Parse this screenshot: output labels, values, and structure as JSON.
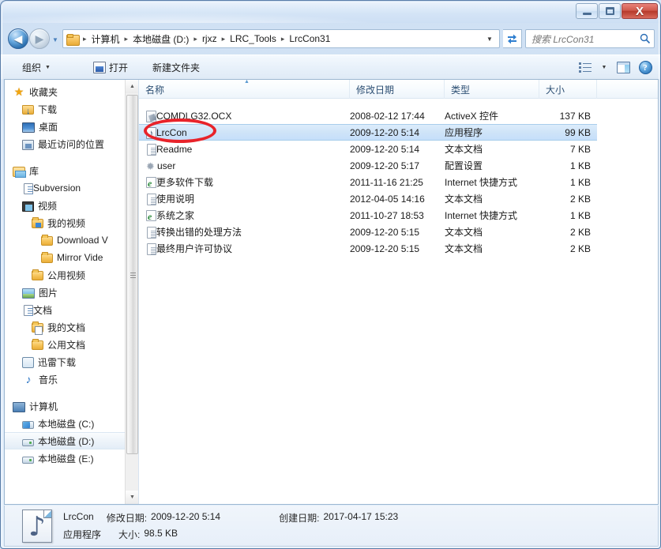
{
  "window": {
    "controls": {
      "minimize_label": "最小化",
      "maximize_label": "最大化",
      "close_label": "X"
    }
  },
  "address_bar": {
    "back_label": "◀",
    "forward_label": "▶",
    "history_caret": "▼",
    "dropdown_caret": "▼",
    "refresh_label": "↻",
    "breadcrumbs": [
      {
        "label": "计算机"
      },
      {
        "label": "本地磁盘 (D:)"
      },
      {
        "label": "rjxz"
      },
      {
        "label": "LRC_Tools"
      },
      {
        "label": "LrcCon31"
      }
    ],
    "separator": "▸"
  },
  "search": {
    "placeholder": "搜索 LrcCon31",
    "icon": "search-icon"
  },
  "toolbar": {
    "organize_label": "组织",
    "organize_caret": "▼",
    "open_label": "打开",
    "new_folder_label": "新建文件夹",
    "views_caret": "▼",
    "help_label": "?"
  },
  "sidebar": {
    "groups": [
      {
        "items": [
          {
            "label": "收藏夹",
            "icon": "star-icon",
            "indent": 0,
            "selected": false
          },
          {
            "label": "下载",
            "icon": "download-folder-icon",
            "indent": 1,
            "selected": false
          },
          {
            "label": "桌面",
            "icon": "desktop-icon",
            "indent": 1,
            "selected": false
          },
          {
            "label": "最近访问的位置",
            "icon": "recent-places-icon",
            "indent": 1,
            "selected": false
          }
        ]
      },
      {
        "items": [
          {
            "label": "库",
            "icon": "library-icon",
            "indent": 0,
            "selected": false
          },
          {
            "label": "Subversion",
            "icon": "document-icon",
            "indent": 1,
            "selected": false
          },
          {
            "label": "视频",
            "icon": "video-icon",
            "indent": 1,
            "selected": false
          },
          {
            "label": "我的视频",
            "icon": "folder-video-icon",
            "indent": 2,
            "selected": false
          },
          {
            "label": "Download V",
            "icon": "folder-icon",
            "indent": 3,
            "selected": false
          },
          {
            "label": "Mirror Vide",
            "icon": "folder-icon",
            "indent": 3,
            "selected": false
          },
          {
            "label": "公用视频",
            "icon": "folder-icon",
            "indent": 2,
            "selected": false
          },
          {
            "label": "图片",
            "icon": "picture-icon",
            "indent": 1,
            "selected": false
          },
          {
            "label": "文档",
            "icon": "document-icon",
            "indent": 1,
            "selected": false
          },
          {
            "label": "我的文档",
            "icon": "folder-doc-icon",
            "indent": 2,
            "selected": false
          },
          {
            "label": "公用文档",
            "icon": "folder-icon",
            "indent": 2,
            "selected": false
          },
          {
            "label": "迅雷下载",
            "icon": "thunder-download-icon",
            "indent": 1,
            "selected": false
          },
          {
            "label": "音乐",
            "icon": "music-icon",
            "indent": 1,
            "selected": false
          }
        ]
      },
      {
        "items": [
          {
            "label": "计算机",
            "icon": "computer-icon",
            "indent": 0,
            "selected": false
          },
          {
            "label": "本地磁盘 (C:)",
            "icon": "drive-system-icon",
            "indent": 1,
            "selected": false
          },
          {
            "label": "本地磁盘 (D:)",
            "icon": "drive-icon",
            "indent": 1,
            "selected": true
          },
          {
            "label": "本地磁盘 (E:)",
            "icon": "drive-icon",
            "indent": 1,
            "selected": false
          }
        ]
      }
    ],
    "scroll_up": "▲",
    "scroll_down": "▼"
  },
  "file_list": {
    "columns": [
      {
        "label": "名称",
        "sorted": true
      },
      {
        "label": "修改日期",
        "sorted": false
      },
      {
        "label": "类型",
        "sorted": false
      },
      {
        "label": "大小",
        "sorted": false
      }
    ],
    "rows": [
      {
        "name": "COMDLG32.OCX",
        "date": "2008-02-12 17:44",
        "type": "ActiveX 控件",
        "size": "137 KB",
        "icon": "ocx-file-icon",
        "selected": false
      },
      {
        "name": "LrcCon",
        "date": "2009-12-20 5:14",
        "type": "应用程序",
        "size": "99 KB",
        "icon": "application-music-icon",
        "selected": true
      },
      {
        "name": "Readme",
        "date": "2009-12-20 5:14",
        "type": "文本文档",
        "size": "7 KB",
        "icon": "text-file-icon",
        "selected": false
      },
      {
        "name": "user",
        "date": "2009-12-20 5:17",
        "type": "配置设置",
        "size": "1 KB",
        "icon": "config-file-icon",
        "selected": false
      },
      {
        "name": "更多软件下载",
        "date": "2011-11-16 21:25",
        "type": "Internet 快捷方式",
        "size": "1 KB",
        "icon": "internet-shortcut-icon",
        "selected": false
      },
      {
        "name": "使用说明",
        "date": "2012-04-05 14:16",
        "type": "文本文档",
        "size": "2 KB",
        "icon": "text-file-icon",
        "selected": false
      },
      {
        "name": "系统之家",
        "date": "2011-10-27 18:53",
        "type": "Internet 快捷方式",
        "size": "1 KB",
        "icon": "internet-shortcut-icon",
        "selected": false
      },
      {
        "name": "转换出错的处理方法",
        "date": "2009-12-20 5:15",
        "type": "文本文档",
        "size": "2 KB",
        "icon": "text-file-icon",
        "selected": false
      },
      {
        "name": "最终用户许可协议",
        "date": "2009-12-20 5:15",
        "type": "文本文档",
        "size": "2 KB",
        "icon": "text-file-icon",
        "selected": false
      }
    ]
  },
  "details_pane": {
    "file_name": "LrcCon",
    "modified_label": "修改日期:",
    "modified_value": "2009-12-20 5:14",
    "created_label": "创建日期:",
    "created_value": "2017-04-17 15:23",
    "file_type": "应用程序",
    "size_label": "大小:",
    "size_value": "98.5 KB"
  },
  "annotation": {
    "shape": "ellipse",
    "color": "#e8232a",
    "target": "LrcCon"
  }
}
